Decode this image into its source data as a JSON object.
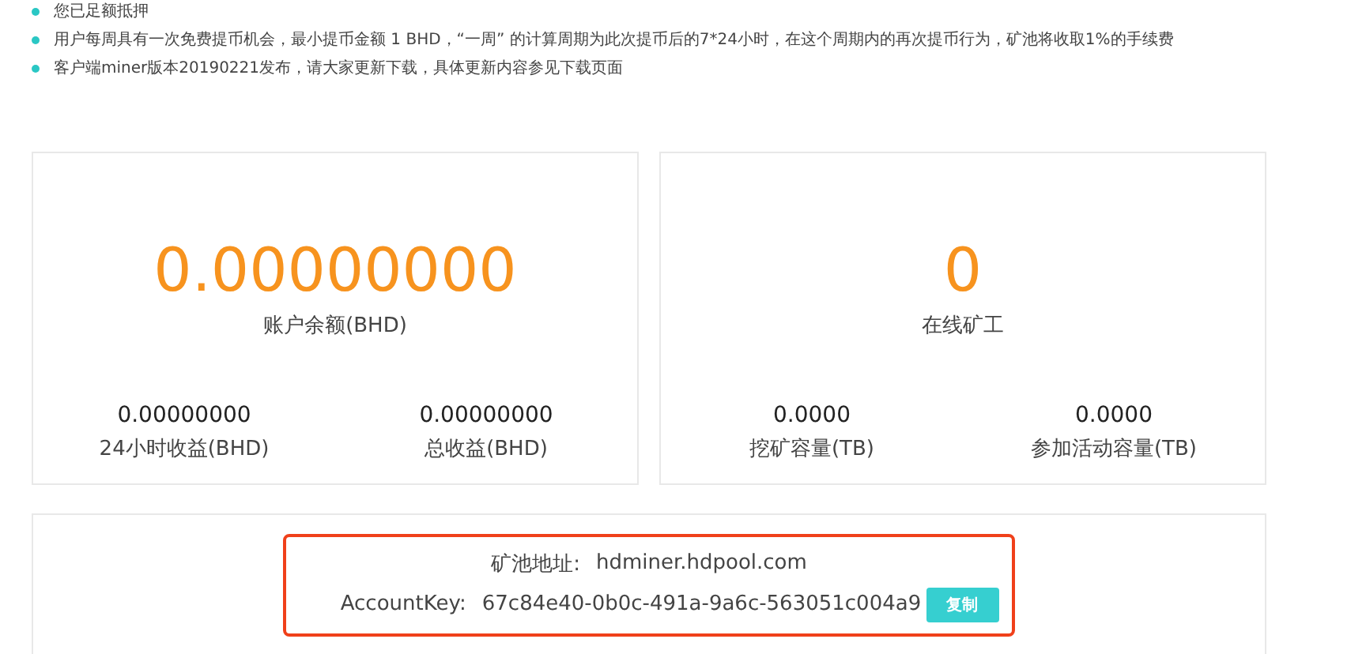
{
  "notices": [
    "您已足额抵押",
    "用户每周具有一次免费提币机会，最小提币金额 1 BHD，“一周” 的计算周期为此次提币后的7*24小时，在这个周期内的再次提币行为，矿池将收取1%的手续费",
    "客户端miner版本20190221发布，请大家更新下载，具体更新内容参见下载页面"
  ],
  "cards": [
    {
      "main_value": "0.00000000",
      "main_label": "账户余额(BHD)",
      "stats": [
        {
          "value": "0.00000000",
          "label": "24小时收益(BHD)"
        },
        {
          "value": "0.00000000",
          "label": "总收益(BHD)"
        }
      ]
    },
    {
      "main_value": "0",
      "main_label": "在线矿工",
      "stats": [
        {
          "value": "0.0000",
          "label": "挖矿容量(TB)"
        },
        {
          "value": "0.0000",
          "label": "参加活动容量(TB)"
        }
      ]
    }
  ],
  "pool_info": {
    "address_label": "矿池地址:",
    "address": "hdminer.hdpool.com",
    "key_label": "AccountKey:",
    "key": "67c84e40-0b0c-491a-9a6c-563051c004a9",
    "copy_button": "复制"
  }
}
